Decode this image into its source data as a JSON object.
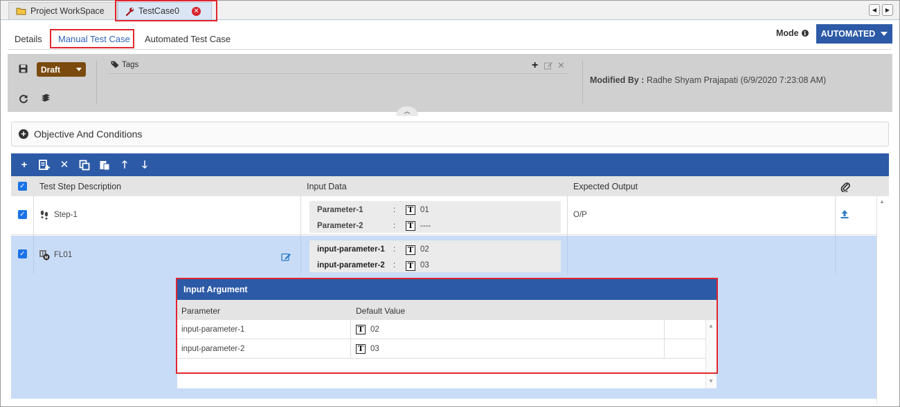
{
  "doc_tabs": [
    {
      "label": "Project WorkSpace",
      "icon": "folder-icon"
    },
    {
      "label": "TestCase0",
      "icon": "wrench-icon",
      "active": true
    }
  ],
  "sub_tabs": [
    "Details",
    "Manual Test Case",
    "Automated Test Case"
  ],
  "mode": {
    "label": "Mode",
    "button": "AUTOMATED"
  },
  "toolbar": {
    "status": "Draft",
    "tags_label": "Tags",
    "modified_by_label": "Modified By :",
    "modified_by_value": "Radhe Shyam Prajapati (6/9/2020 7:23:08 AM)"
  },
  "objective": {
    "label": "Objective And Conditions"
  },
  "grid": {
    "columns": [
      "Test Step Description",
      "Input Data",
      "Expected Output"
    ],
    "rows": [
      {
        "description": "Step-1",
        "params": [
          {
            "name": "Parameter-1",
            "value": "01"
          },
          {
            "name": "Parameter-2",
            "value": "----"
          }
        ],
        "expected": "O/P"
      },
      {
        "description": "FL01",
        "params": [
          {
            "name": "input-parameter-1",
            "value": "02"
          },
          {
            "name": "input-parameter-2",
            "value": "03"
          }
        ],
        "expected": ""
      }
    ]
  },
  "input_argument": {
    "title": "Input Argument",
    "columns": [
      "Parameter",
      "Default Value"
    ],
    "rows": [
      {
        "parameter": "input-parameter-1",
        "value": "02"
      },
      {
        "parameter": "input-parameter-2",
        "value": "03"
      }
    ]
  },
  "colors": {
    "accent": "#2c5aa6",
    "highlight": "#e0262e",
    "draft": "#7a4a0e",
    "selected_row": "#c9dcf7"
  }
}
